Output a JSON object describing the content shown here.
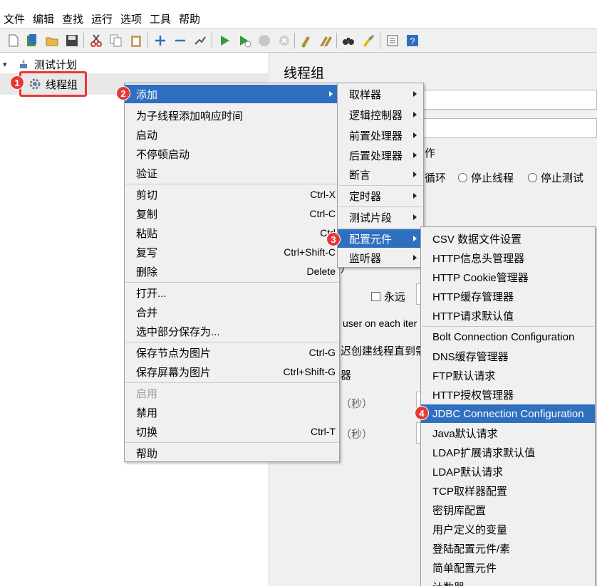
{
  "menubar": [
    "文件",
    "编辑",
    "查找",
    "运行",
    "选项",
    "工具",
    "帮助"
  ],
  "toolbar": {
    "icons": [
      "new-icon",
      "templates-icon",
      "open-icon",
      "save-icon",
      "cut-icon",
      "copy-icon",
      "paste-icon",
      "expand-icon",
      "collapse-icon",
      "toggle-icon",
      "start-icon",
      "start-no-pause-icon",
      "stop-icon",
      "shutdown-icon",
      "clear-icon",
      "clear-all-icon",
      "search-icon",
      "reset-search-icon",
      "function-helper-icon",
      "help-icon"
    ]
  },
  "tree": {
    "root_label": "测试计划",
    "child_label": "线程组"
  },
  "right_panel": {
    "title": "线程组",
    "action_fragment": "作",
    "radio_loop": "循环",
    "radio_stop_thread": "停止线程",
    "radio_stop_test": "停止测试",
    "forever_label": "永远",
    "same_user_text": "user on each iter",
    "delay_text": "迟创建线程直到需要",
    "sec1": "（秒）",
    "sec2": "（秒）",
    "frag_yi": "）",
    "frag_ci": "器"
  },
  "context_menu": {
    "items": [
      {
        "label": "添加",
        "submenu": true,
        "active": true
      },
      {
        "label": "为子线程添加响应时间"
      },
      {
        "label": "启动"
      },
      {
        "label": "不停顿启动"
      },
      {
        "label": "验证"
      },
      {
        "label": "剪切",
        "shortcut": "Ctrl-X"
      },
      {
        "label": "复制",
        "shortcut": "Ctrl-C"
      },
      {
        "label": "粘贴",
        "shortcut": "Ctrl"
      },
      {
        "label": "复写",
        "shortcut": "Ctrl+Shift-C"
      },
      {
        "label": "删除",
        "shortcut": "Delete"
      },
      {
        "label": "打开..."
      },
      {
        "label": "合并"
      },
      {
        "label": "选中部分保存为..."
      },
      {
        "label": "保存节点为图片",
        "shortcut": "Ctrl-G"
      },
      {
        "label": "保存屏幕为图片",
        "shortcut": "Ctrl+Shift-G"
      },
      {
        "label": "启用",
        "disabled": true
      },
      {
        "label": "禁用"
      },
      {
        "label": "切换",
        "shortcut": "Ctrl-T"
      },
      {
        "label": "帮助"
      }
    ]
  },
  "add_submenu": {
    "items": [
      "取样器",
      "逻辑控制器",
      "前置处理器",
      "后置处理器",
      "断言",
      "定时器",
      "测试片段",
      "配置元件",
      "监听器"
    ],
    "active": "配置元件"
  },
  "config_submenu": {
    "items": [
      "CSV 数据文件设置",
      "HTTP信息头管理器",
      "HTTP Cookie管理器",
      "HTTP缓存管理器",
      "HTTP请求默认值",
      "Bolt Connection Configuration",
      "DNS缓存管理器",
      "FTP默认请求",
      "HTTP授权管理器",
      "JDBC Connection Configuration",
      "Java默认请求",
      "LDAP扩展请求默认值",
      "LDAP默认请求",
      "TCP取样器配置",
      "密钥库配置",
      "用户定义的变量",
      "登陆配置元件/素",
      "简单配置元件",
      "计数器"
    ],
    "highlighted": "JDBC Connection Configuration"
  },
  "badges": [
    "1",
    "2",
    "3",
    "4"
  ],
  "colors": {
    "accent": "#2f6fbf",
    "badge": "#e53935",
    "menu_bg": "#f0f0f0"
  }
}
